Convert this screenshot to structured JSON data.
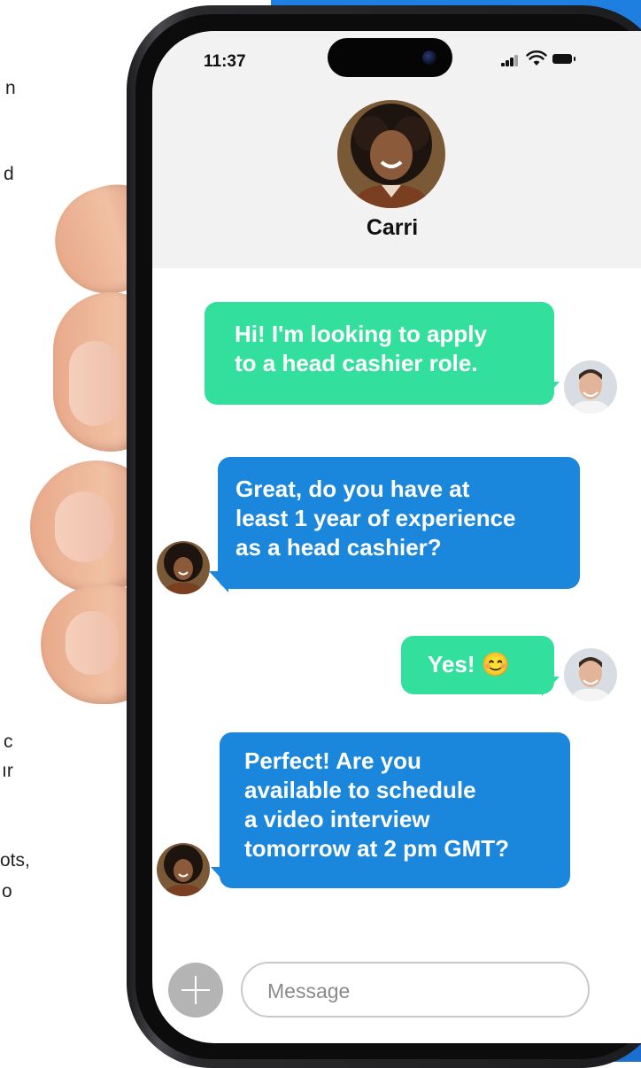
{
  "background_text": {
    "frag_1": "n",
    "frag_2": "d",
    "frag_3": "c",
    "frag_4": "ır",
    "frag_5": "ots,",
    "frag_6": "o"
  },
  "status_bar": {
    "time": "11:37"
  },
  "contact": {
    "name": "Carri"
  },
  "messages": [
    {
      "sender": "user",
      "text_lines": [
        "Hi! I'm looking to apply",
        "to a head cashier role."
      ]
    },
    {
      "sender": "bot",
      "text_lines": [
        "Great, do you have at",
        "least 1 year of experience",
        "as a head cashier?"
      ]
    },
    {
      "sender": "user",
      "text": "Yes! 😊"
    },
    {
      "sender": "bot",
      "text_lines": [
        "Perfect! Are you",
        "available to schedule",
        "a video interview",
        "tomorrow at 2 pm GMT?"
      ]
    }
  ],
  "composer": {
    "placeholder": "Message"
  },
  "colors": {
    "user_bubble": "#33df9c",
    "bot_bubble": "#1a86dc",
    "panel": "#1f7fe0"
  },
  "icons": [
    "signal-icon",
    "wifi-icon",
    "battery-icon",
    "plus-icon"
  ]
}
